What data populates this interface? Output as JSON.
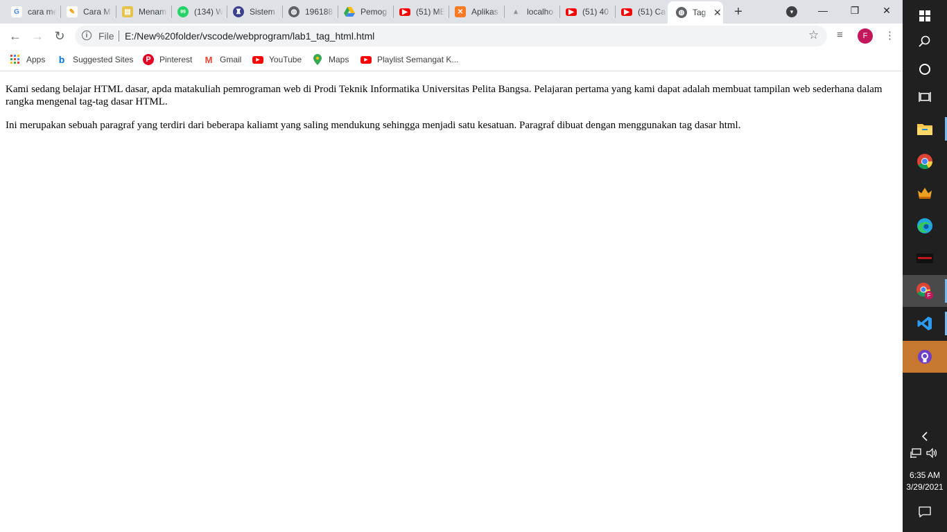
{
  "tabs": [
    {
      "title": "cara me",
      "icon": "google-icon"
    },
    {
      "title": "Cara M",
      "icon": "blog-icon"
    },
    {
      "title": "Menam",
      "icon": "app-icon"
    },
    {
      "title": "(134) W",
      "icon": "whatsapp-icon"
    },
    {
      "title": "Sistem",
      "icon": "university-icon"
    },
    {
      "title": "196188",
      "icon": "globe-icon"
    },
    {
      "title": "Pemog",
      "icon": "drive-icon"
    },
    {
      "title": "(51) ME",
      "icon": "youtube-icon"
    },
    {
      "title": "Aplikas",
      "icon": "xampp-icon"
    },
    {
      "title": "localho",
      "icon": "localhost-icon"
    },
    {
      "title": "(51) 40",
      "icon": "youtube-icon"
    },
    {
      "title": "(51) Ca",
      "icon": "youtube-icon"
    },
    {
      "title": "Tag",
      "icon": "globe-icon",
      "active": true
    }
  ],
  "omnibox": {
    "scheme": "File",
    "url": "E:/New%20folder/vscode/webprogram/lab1_tag_html.html"
  },
  "profile": {
    "initial": "F",
    "color": "#c2185b"
  },
  "bookmarks": [
    {
      "label": "Apps",
      "icon": "apps-grid-icon"
    },
    {
      "label": "Suggested Sites",
      "icon": "bing-icon"
    },
    {
      "label": "Pinterest",
      "icon": "pinterest-icon"
    },
    {
      "label": "Gmail",
      "icon": "gmail-icon"
    },
    {
      "label": "YouTube",
      "icon": "youtube-icon"
    },
    {
      "label": "Maps",
      "icon": "maps-icon"
    },
    {
      "label": "Playlist Semangat K...",
      "icon": "youtube-icon"
    }
  ],
  "page": {
    "paragraph1": "Kami sedang belajar HTML dasar, apda matakuliah pemrograman web di Prodi Teknik Informatika Universitas Pelita Bangsa. Pelajaran pertama yang kami dapat adalah membuat tampilan web sederhana dalam rangka mengenal tag-tag dasar HTML.",
    "paragraph2": "Ini merupakan sebuah paragraf yang terdiri dari beberapa kaliamt yang saling mendukung sehingga menjadi satu kesatuan. Paragraf dibuat dengan menggunakan tag dasar html."
  },
  "taskbar": {
    "time": "6:35 AM",
    "date": "3/29/2021",
    "pinned": [
      "start-icon",
      "search-icon",
      "cortana-icon",
      "task-view-icon",
      "file-explorer-icon",
      "chrome-icon",
      "game-app-icon",
      "edge-icon",
      "media-app-icon",
      "chrome-profile-icon",
      "vscode-icon",
      "github-desktop-icon"
    ]
  }
}
